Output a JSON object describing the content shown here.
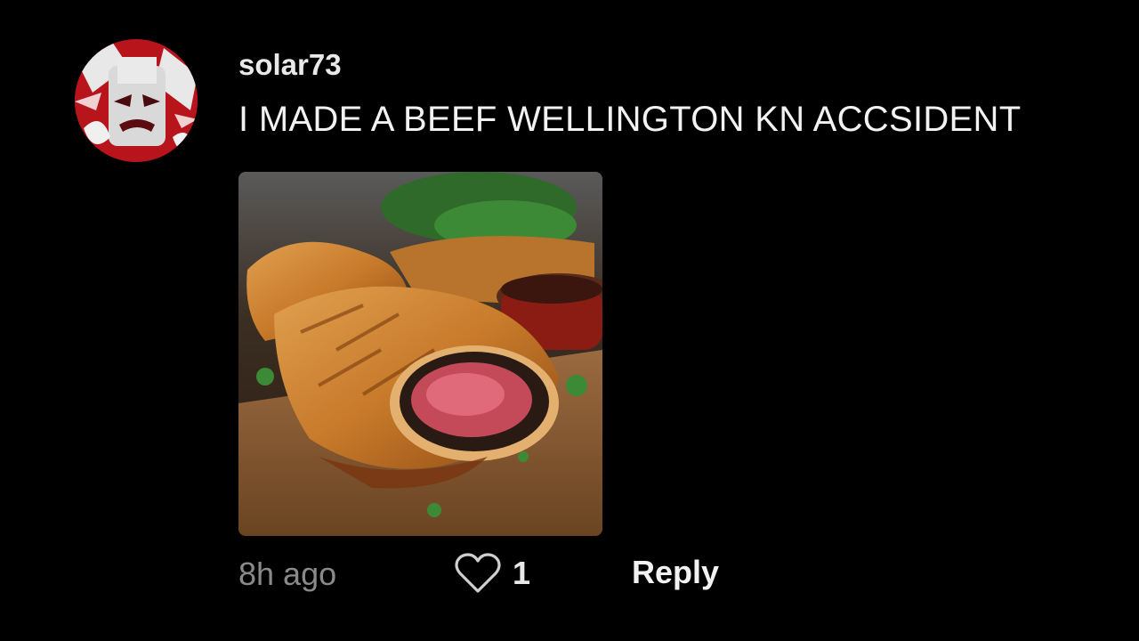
{
  "comment": {
    "username": "solar73",
    "text": "I MADE A BEEF WELLINGTON KN ACCSIDENT",
    "timestamp": "8h ago",
    "like_count": "1",
    "reply_label": "Reply",
    "avatar_icon": "avatar-image",
    "attachment_icon": "beef-wellington-photo",
    "like_icon": "heart-outline-icon"
  },
  "colors": {
    "background": "#000000",
    "text_primary": "#f2f2f2",
    "text_secondary": "#8a8a8a",
    "avatar_accent": "#b8141c"
  }
}
